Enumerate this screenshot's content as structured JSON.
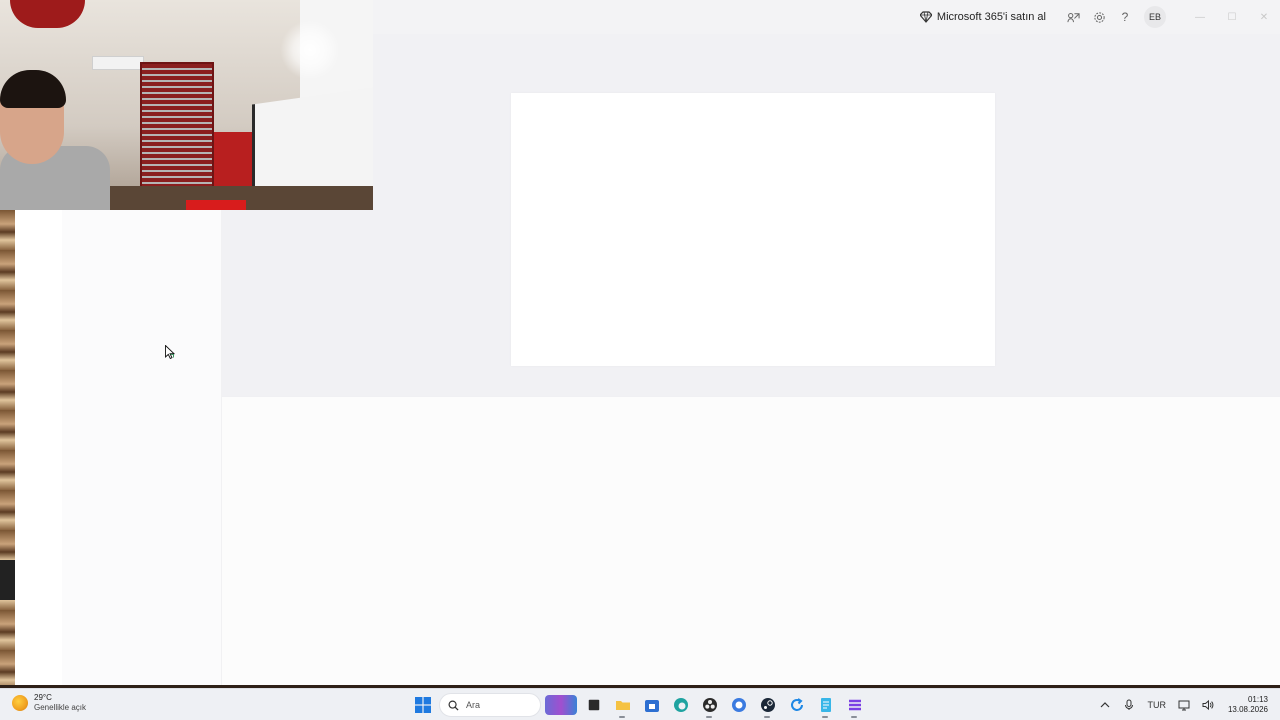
{
  "titlebar": {
    "buy_label": "Microsoft 365'i satın al",
    "share_icon": "share-icon",
    "settings_icon": "gear-icon",
    "help_label": "?",
    "avatar_initials": "EB",
    "minimize_label": "—",
    "maximize_label": "☐",
    "close_label": "✕"
  },
  "taskbar": {
    "weather": {
      "temp": "29°C",
      "desc": "Genellikle açık"
    },
    "search_placeholder": "Ara",
    "apps": [
      {
        "name": "start",
        "color": "#1f7ae0"
      },
      {
        "name": "file-explorer",
        "color": "#f5c242"
      },
      {
        "name": "store",
        "color": "#2d6fd1"
      },
      {
        "name": "edge",
        "color": "#1fa3a0"
      },
      {
        "name": "obs",
        "color": "#2b2b2b"
      },
      {
        "name": "browser",
        "color": "#3b7be0"
      },
      {
        "name": "steam",
        "color": "#1b2838"
      },
      {
        "name": "refresh-app",
        "color": "#1e88e5"
      },
      {
        "name": "notepad",
        "color": "#38b6e8"
      },
      {
        "name": "stack-app",
        "color": "#7b3fe4"
      }
    ],
    "tray": {
      "language": "TUR",
      "time": "01:13",
      "date": "13.08.2026"
    }
  },
  "colors": {
    "window_bg": "#f3f3f5",
    "card_bg": "#ffffff",
    "taskbar_bg": "#eef0f4"
  }
}
